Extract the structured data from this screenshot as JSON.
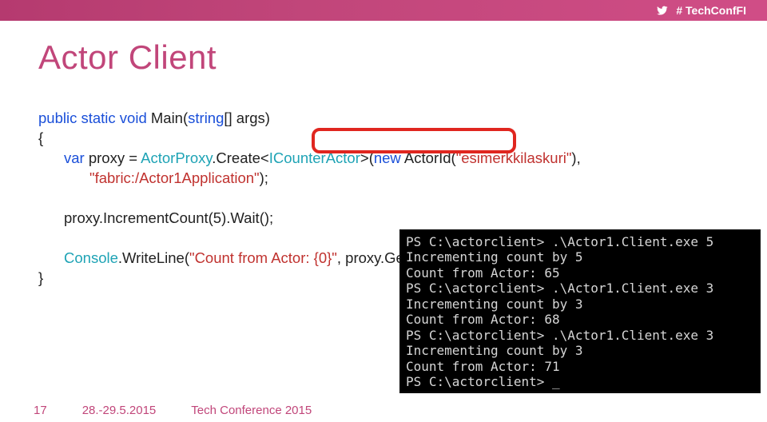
{
  "hashtag": "# TechConfFI",
  "title": "Actor Client",
  "code": {
    "sig_kw1": "public static void",
    "sig_name": " Main(",
    "sig_kw2": "string",
    "sig_tail": "[] args)",
    "open": "{",
    "var_kw": "var",
    "var_rest": " proxy = ",
    "actorproxy": "ActorProxy",
    "create": ".Create<",
    "icounter": "ICounterActor",
    "create_tail": ">(",
    "new_kw": "new",
    "actid_open": " ActorId(",
    "actid_str": "\"esimerkkilaskuri\"",
    "actid_close": "),",
    "fabric_str": "\"fabric:/Actor1Application\"",
    "fabric_close": ");",
    "inc_line": "proxy.IncrementCount(5).Wait();",
    "cons_cls": "Console",
    "cons_call": ".WriteLine(",
    "cons_str": "\"Count from Actor: {0}\"",
    "cons_tail": ", proxy.GetCount().Result);",
    "close": "}"
  },
  "console_lines": [
    "PS C:\\actorclient> .\\Actor1.Client.exe 5",
    "Incrementing count by 5",
    "Count from Actor: 65",
    "PS C:\\actorclient> .\\Actor1.Client.exe 3",
    "Incrementing count by 3",
    "Count from Actor: 68",
    "PS C:\\actorclient> .\\Actor1.Client.exe 3",
    "Incrementing count by 3",
    "Count from Actor: 71",
    "PS C:\\actorclient> _"
  ],
  "footer": {
    "page": "17",
    "dates": "28.-29.5.2015",
    "conference": "Tech Conference 2015"
  }
}
